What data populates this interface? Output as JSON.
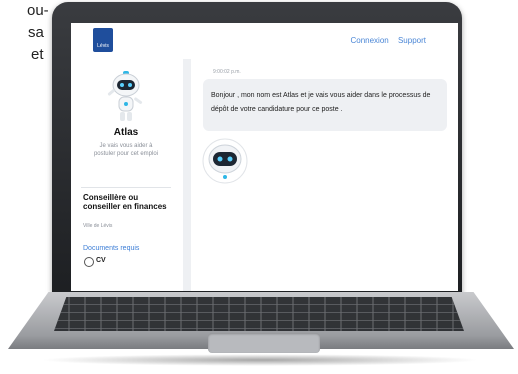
{
  "background_text": {
    "line1": "ou-",
    "line2": "sa",
    "line3": "et"
  },
  "app": {
    "logo_text": "Lévis",
    "nav": {
      "login": "Connexion",
      "support": "Support"
    }
  },
  "sidebar": {
    "assistant_name": "Atlas",
    "assistant_desc": "Je vais vous aider à postuler pour cet emploi",
    "job_title": "Conseillère ou conseiller en finances",
    "job_org": "Ville de Lévis",
    "docs_label": "Documents requis",
    "docs": [
      {
        "label": "CV"
      }
    ]
  },
  "chat": {
    "timestamp": "9:00:02 p.m.",
    "message": "Bonjour , mon nom est Atlas et je vais vous aider dans le processus de dépôt de votre candidature pour ce poste ."
  },
  "colors": {
    "accent": "#3d7ed6",
    "logo": "#1f4e9c",
    "bubble": "#eef0f3"
  }
}
